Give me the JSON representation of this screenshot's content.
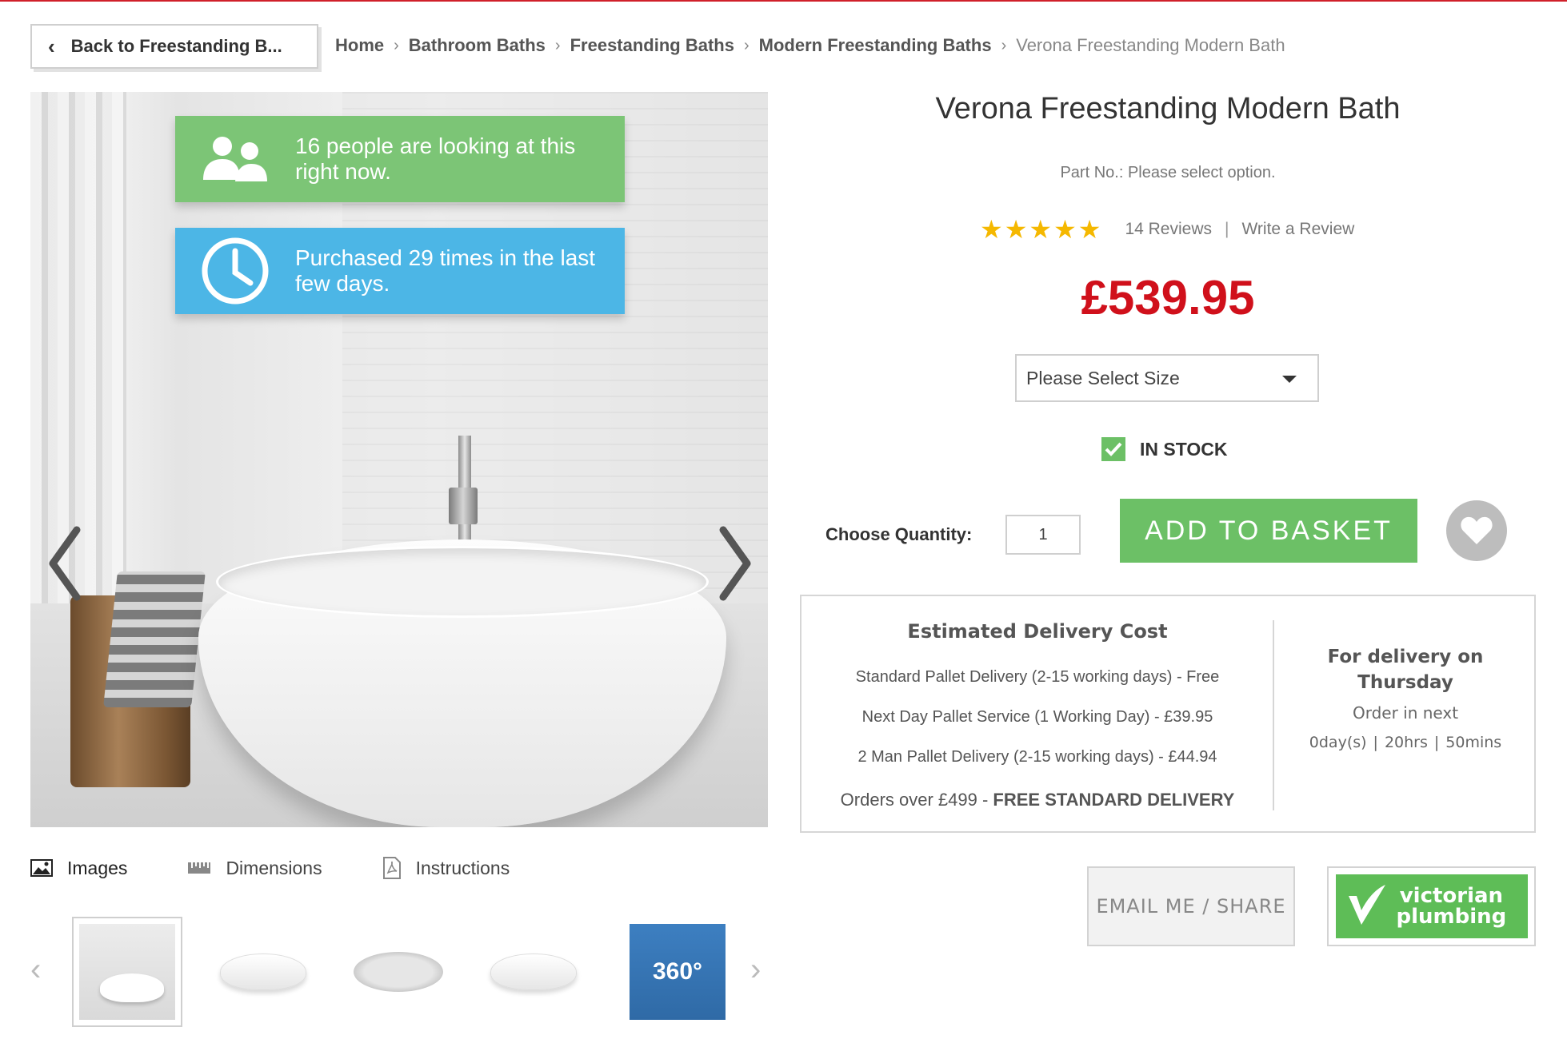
{
  "back_button": {
    "label": "Back to Freestanding B..."
  },
  "breadcrumb": {
    "items": [
      "Home",
      "Bathroom Baths",
      "Freestanding Baths",
      "Modern Freestanding Baths"
    ],
    "current": "Verona Freestanding Modern Bath"
  },
  "gallery": {
    "banner_viewers": "16 people are looking at this right now.",
    "banner_purchased": "Purchased 29 times in the last few days.",
    "tabs": [
      "Images",
      "Dimensions",
      "Instructions"
    ],
    "thumb_360_label": "360°"
  },
  "product": {
    "title": "Verona Freestanding Modern Bath",
    "part_no": "Part No.: Please select option.",
    "rating_stars": "★★★★★",
    "rating_value": 5,
    "reviews": "14 Reviews",
    "write_review": "Write a Review",
    "price": "£539.95",
    "size_select": "Please Select Size",
    "stock": "IN STOCK",
    "quantity_label": "Choose Quantity:",
    "quantity_value": "1",
    "add_to_basket": "ADD TO BASKET"
  },
  "delivery": {
    "heading": "Estimated Delivery Cost",
    "options": [
      "Standard Pallet Delivery (2-15 working days) - Free",
      "Next Day Pallet Service (1 Working Day) - £39.95",
      "2 Man Pallet Delivery (2-15 working days) - £44.94"
    ],
    "orders_prefix": "Orders over £499 - ",
    "orders_bold": "FREE STANDARD DELIVERY",
    "delivery_on_line1": "For delivery on",
    "delivery_on_line2": "Thursday",
    "order_in": "Order in next",
    "days": "0day(s)",
    "hours": "20hrs",
    "mins": "50mins"
  },
  "share": {
    "email_label": "EMAIL ME / SHARE"
  },
  "brand": {
    "line1": "victorian",
    "line2": "plumbing"
  },
  "colors": {
    "green": "#6cc066",
    "blue": "#4cb6e6",
    "price_red": "#d0101b",
    "star": "#f5b800"
  }
}
